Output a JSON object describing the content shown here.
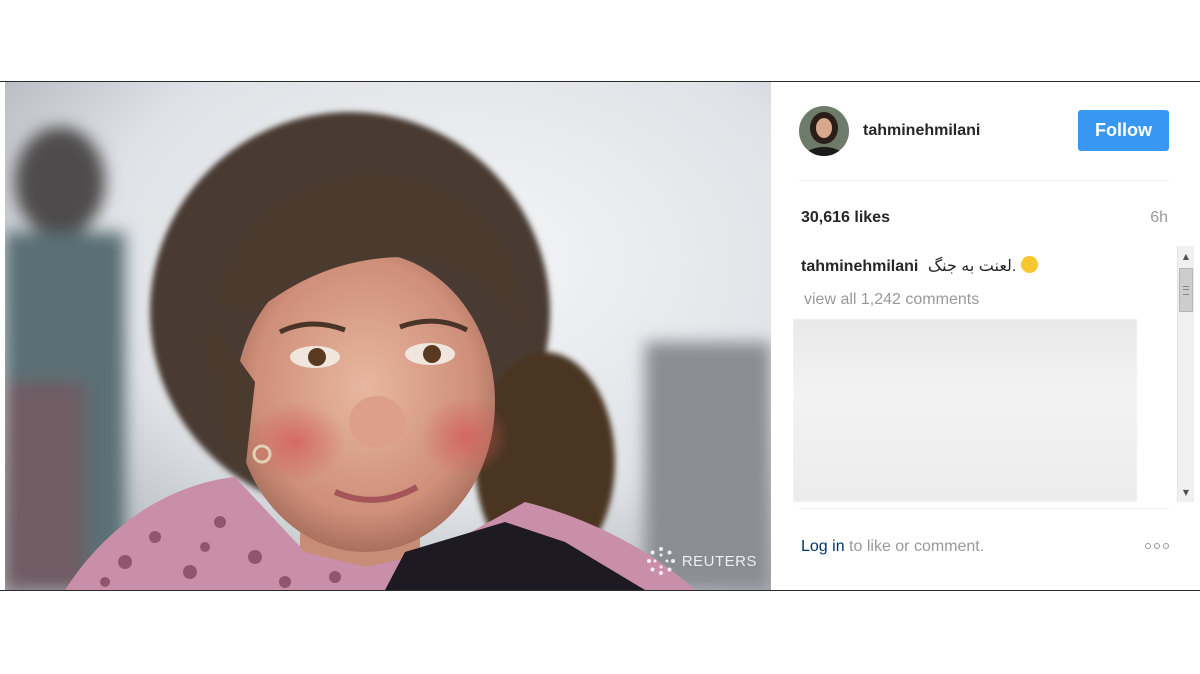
{
  "photo": {
    "alt": "Close-up photo of a young girl with curly brown hair and rosy cheeks, smiling with teary eyes",
    "watermark": "REUTERS"
  },
  "post": {
    "username": "tahminehmilani",
    "follow_label": "Follow",
    "likes": "30,616 likes",
    "time": "6h",
    "caption_user": "tahminehmilani",
    "caption_text": "لعنت به جنگ.",
    "view_all_comments": "view all 1,242 comments",
    "login_link": "Log in",
    "login_suffix": " to like or comment."
  },
  "colors": {
    "follow_button": "#3897f0",
    "login_link": "#003569",
    "muted_text": "#999999"
  },
  "icons": {
    "more": "more-options-icon",
    "scroll_up": "scroll-up-arrow-icon",
    "scroll_down": "scroll-down-arrow-icon"
  }
}
